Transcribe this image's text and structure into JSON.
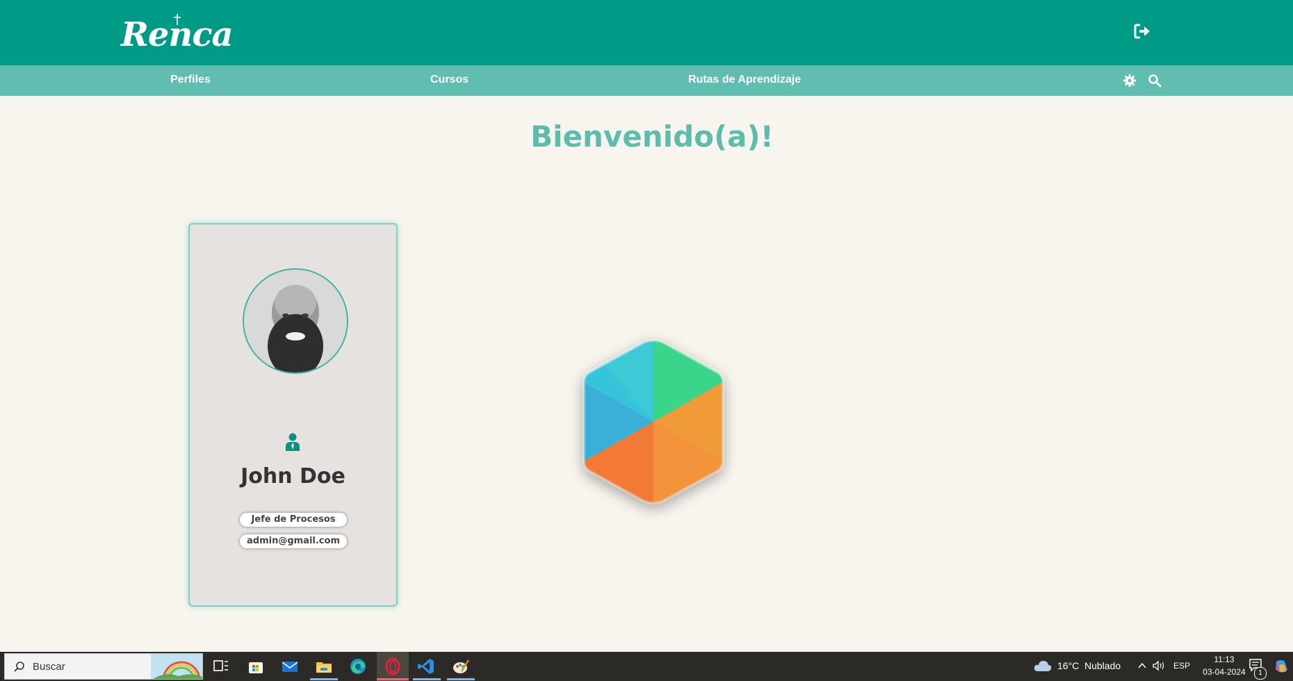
{
  "header": {
    "logo_text": "Renca"
  },
  "nav": {
    "items": [
      {
        "label": "Perfiles"
      },
      {
        "label": "Cursos"
      },
      {
        "label": "Rutas de Aprendizaje"
      }
    ],
    "icons": [
      "settings-gear-icon",
      "search-icon"
    ]
  },
  "main": {
    "welcome_title": "Bienvenido(a)!",
    "profile": {
      "name": "John Doe",
      "role": "Jefe de Procesos",
      "email": "admin@gmail.com"
    }
  },
  "taskbar": {
    "search_placeholder": "Buscar",
    "weather_temp": "16°C",
    "weather_desc": "Nublado",
    "language": "ESP",
    "time": "11:13",
    "date": "03-04-2024",
    "notification_count": "1",
    "apps": [
      "task-view-icon",
      "store-icon",
      "mail-icon",
      "file-explorer-icon",
      "edge-icon",
      "opera-icon",
      "vscode-icon",
      "paint-icon"
    ]
  },
  "colors": {
    "header_bg": "#009b87",
    "nav_bg": "#60bdb0",
    "accent": "#5dbdad",
    "page_bg": "#f7f5ee",
    "card_bg": "#e6e2e0"
  }
}
